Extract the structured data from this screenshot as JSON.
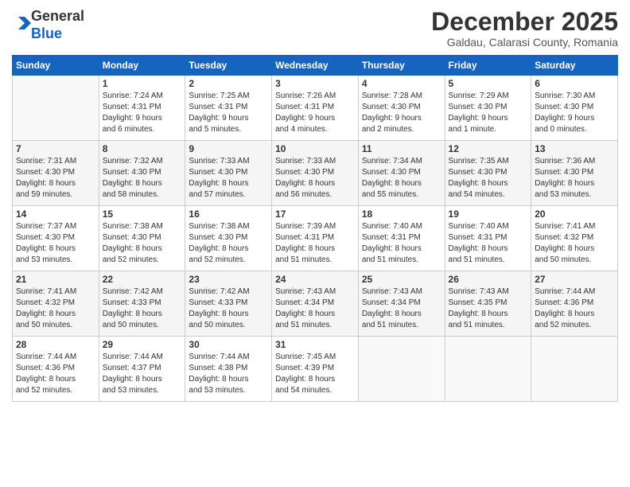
{
  "logo": {
    "general": "General",
    "blue": "Blue"
  },
  "header": {
    "month": "December 2025",
    "location": "Galdau, Calarasi County, Romania"
  },
  "weekdays": [
    "Sunday",
    "Monday",
    "Tuesday",
    "Wednesday",
    "Thursday",
    "Friday",
    "Saturday"
  ],
  "weeks": [
    [
      {
        "day": "",
        "info": ""
      },
      {
        "day": "1",
        "info": "Sunrise: 7:24 AM\nSunset: 4:31 PM\nDaylight: 9 hours\nand 6 minutes."
      },
      {
        "day": "2",
        "info": "Sunrise: 7:25 AM\nSunset: 4:31 PM\nDaylight: 9 hours\nand 5 minutes."
      },
      {
        "day": "3",
        "info": "Sunrise: 7:26 AM\nSunset: 4:31 PM\nDaylight: 9 hours\nand 4 minutes."
      },
      {
        "day": "4",
        "info": "Sunrise: 7:28 AM\nSunset: 4:30 PM\nDaylight: 9 hours\nand 2 minutes."
      },
      {
        "day": "5",
        "info": "Sunrise: 7:29 AM\nSunset: 4:30 PM\nDaylight: 9 hours\nand 1 minute."
      },
      {
        "day": "6",
        "info": "Sunrise: 7:30 AM\nSunset: 4:30 PM\nDaylight: 9 hours\nand 0 minutes."
      }
    ],
    [
      {
        "day": "7",
        "info": "Sunrise: 7:31 AM\nSunset: 4:30 PM\nDaylight: 8 hours\nand 59 minutes."
      },
      {
        "day": "8",
        "info": "Sunrise: 7:32 AM\nSunset: 4:30 PM\nDaylight: 8 hours\nand 58 minutes."
      },
      {
        "day": "9",
        "info": "Sunrise: 7:33 AM\nSunset: 4:30 PM\nDaylight: 8 hours\nand 57 minutes."
      },
      {
        "day": "10",
        "info": "Sunrise: 7:33 AM\nSunset: 4:30 PM\nDaylight: 8 hours\nand 56 minutes."
      },
      {
        "day": "11",
        "info": "Sunrise: 7:34 AM\nSunset: 4:30 PM\nDaylight: 8 hours\nand 55 minutes."
      },
      {
        "day": "12",
        "info": "Sunrise: 7:35 AM\nSunset: 4:30 PM\nDaylight: 8 hours\nand 54 minutes."
      },
      {
        "day": "13",
        "info": "Sunrise: 7:36 AM\nSunset: 4:30 PM\nDaylight: 8 hours\nand 53 minutes."
      }
    ],
    [
      {
        "day": "14",
        "info": "Sunrise: 7:37 AM\nSunset: 4:30 PM\nDaylight: 8 hours\nand 53 minutes."
      },
      {
        "day": "15",
        "info": "Sunrise: 7:38 AM\nSunset: 4:30 PM\nDaylight: 8 hours\nand 52 minutes."
      },
      {
        "day": "16",
        "info": "Sunrise: 7:38 AM\nSunset: 4:30 PM\nDaylight: 8 hours\nand 52 minutes."
      },
      {
        "day": "17",
        "info": "Sunrise: 7:39 AM\nSunset: 4:31 PM\nDaylight: 8 hours\nand 51 minutes."
      },
      {
        "day": "18",
        "info": "Sunrise: 7:40 AM\nSunset: 4:31 PM\nDaylight: 8 hours\nand 51 minutes."
      },
      {
        "day": "19",
        "info": "Sunrise: 7:40 AM\nSunset: 4:31 PM\nDaylight: 8 hours\nand 51 minutes."
      },
      {
        "day": "20",
        "info": "Sunrise: 7:41 AM\nSunset: 4:32 PM\nDaylight: 8 hours\nand 50 minutes."
      }
    ],
    [
      {
        "day": "21",
        "info": "Sunrise: 7:41 AM\nSunset: 4:32 PM\nDaylight: 8 hours\nand 50 minutes."
      },
      {
        "day": "22",
        "info": "Sunrise: 7:42 AM\nSunset: 4:33 PM\nDaylight: 8 hours\nand 50 minutes."
      },
      {
        "day": "23",
        "info": "Sunrise: 7:42 AM\nSunset: 4:33 PM\nDaylight: 8 hours\nand 50 minutes."
      },
      {
        "day": "24",
        "info": "Sunrise: 7:43 AM\nSunset: 4:34 PM\nDaylight: 8 hours\nand 51 minutes."
      },
      {
        "day": "25",
        "info": "Sunrise: 7:43 AM\nSunset: 4:34 PM\nDaylight: 8 hours\nand 51 minutes."
      },
      {
        "day": "26",
        "info": "Sunrise: 7:43 AM\nSunset: 4:35 PM\nDaylight: 8 hours\nand 51 minutes."
      },
      {
        "day": "27",
        "info": "Sunrise: 7:44 AM\nSunset: 4:36 PM\nDaylight: 8 hours\nand 52 minutes."
      }
    ],
    [
      {
        "day": "28",
        "info": "Sunrise: 7:44 AM\nSunset: 4:36 PM\nDaylight: 8 hours\nand 52 minutes."
      },
      {
        "day": "29",
        "info": "Sunrise: 7:44 AM\nSunset: 4:37 PM\nDaylight: 8 hours\nand 53 minutes."
      },
      {
        "day": "30",
        "info": "Sunrise: 7:44 AM\nSunset: 4:38 PM\nDaylight: 8 hours\nand 53 minutes."
      },
      {
        "day": "31",
        "info": "Sunrise: 7:45 AM\nSunset: 4:39 PM\nDaylight: 8 hours\nand 54 minutes."
      },
      {
        "day": "",
        "info": ""
      },
      {
        "day": "",
        "info": ""
      },
      {
        "day": "",
        "info": ""
      }
    ]
  ]
}
